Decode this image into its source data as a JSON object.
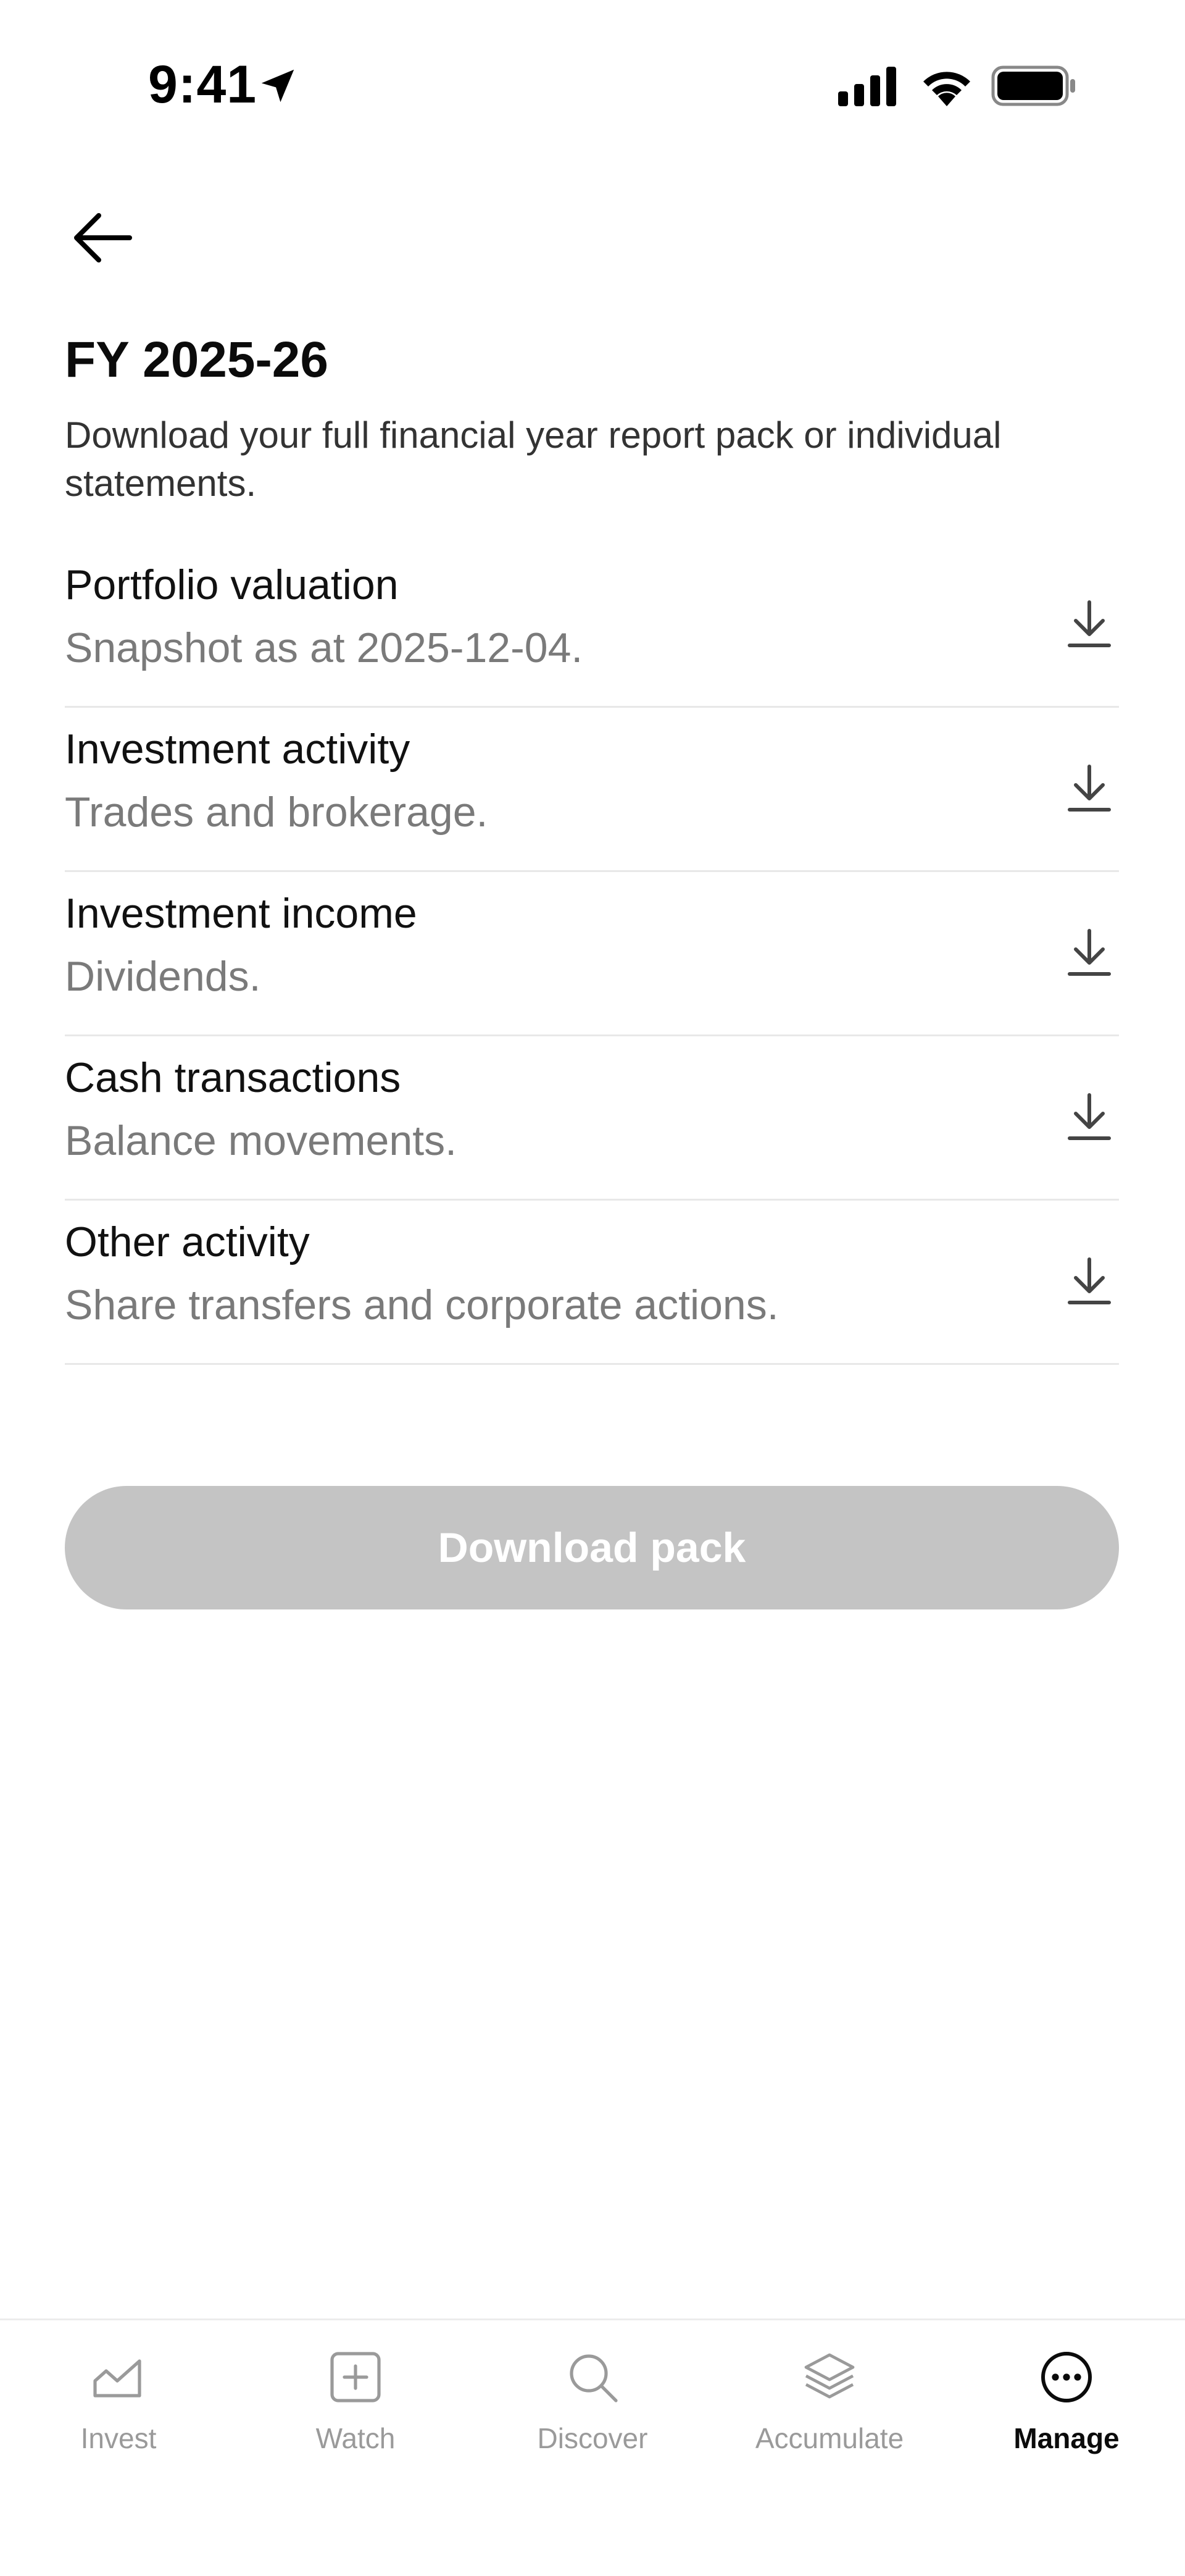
{
  "status_bar": {
    "time": "9:41"
  },
  "header": {
    "title": "FY 2025-26",
    "subtitle": "Download your full financial year report pack or individual statements."
  },
  "reports": [
    {
      "title": "Portfolio valuation",
      "description": "Snapshot as at 2025-12-04."
    },
    {
      "title": "Investment activity",
      "description": "Trades and brokerage."
    },
    {
      "title": "Investment income",
      "description": "Dividends."
    },
    {
      "title": "Cash transactions",
      "description": "Balance movements."
    },
    {
      "title": "Other activity",
      "description": "Share transfers and corporate actions."
    }
  ],
  "download_pack": {
    "label": "Download pack",
    "enabled": false,
    "color": "#c4c4c4"
  },
  "nav": [
    {
      "label": "Invest",
      "icon": "chart-icon",
      "active": false
    },
    {
      "label": "Watch",
      "icon": "plus-square-icon",
      "active": false
    },
    {
      "label": "Discover",
      "icon": "search-icon",
      "active": false
    },
    {
      "label": "Accumulate",
      "icon": "layers-icon",
      "active": false
    },
    {
      "label": "Manage",
      "icon": "more-icon",
      "active": true
    }
  ],
  "colors": {
    "active": "#0b0b0b",
    "inactive": "#9a9a9a",
    "divider": "#e8e8e8"
  }
}
